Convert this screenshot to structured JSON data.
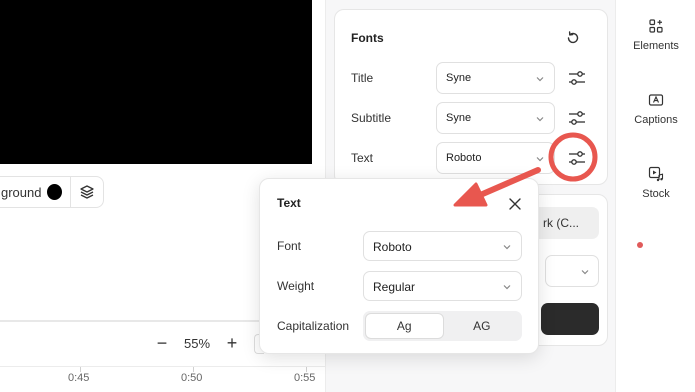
{
  "canvas": {
    "background_label": "ground",
    "background_color": "#000000"
  },
  "timeline": {
    "zoom_value": "55%",
    "zoom_out_symbol": "−",
    "zoom_in_symbol": "+",
    "ticks": [
      "0:45",
      "0:50",
      "0:55"
    ]
  },
  "fonts_panel": {
    "title": "Fonts",
    "rows": [
      {
        "label": "Title",
        "value": "Syne"
      },
      {
        "label": "Subtitle",
        "value": "Syne"
      },
      {
        "label": "Text",
        "value": "Roboto"
      }
    ]
  },
  "second_card": {
    "partial_field": "rk (C..."
  },
  "side_tools": [
    {
      "label": "Elements",
      "icon": "elements-icon"
    },
    {
      "label": "Captions",
      "icon": "captions-icon"
    },
    {
      "label": "Stock",
      "icon": "stock-icon"
    }
  ],
  "popup": {
    "title": "Text",
    "font_label": "Font",
    "font_value": "Roboto",
    "weight_label": "Weight",
    "weight_value": "Regular",
    "capitalization_label": "Capitalization",
    "capitalization_options": [
      "Ag",
      "AG"
    ],
    "capitalization_selected": "Ag"
  },
  "annotation": {
    "color": "#e8574f"
  }
}
